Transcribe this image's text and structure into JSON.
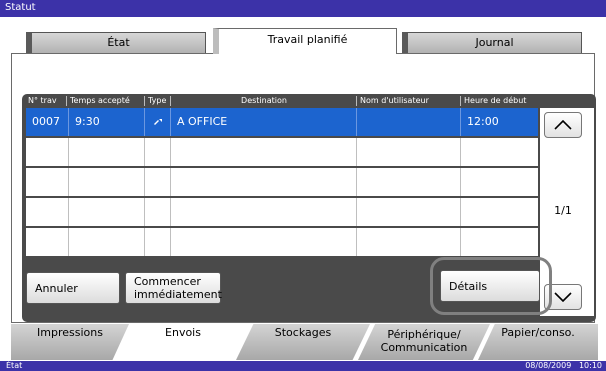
{
  "window": {
    "title": "Statut"
  },
  "top_tabs": [
    {
      "label": "État",
      "active": false
    },
    {
      "label": "Travail planifié",
      "active": true
    },
    {
      "label": "Journal",
      "active": false
    }
  ],
  "table": {
    "headers": [
      "N° trav",
      "Temps accepté",
      "Type",
      "Destination",
      "Nom d'utilisateur",
      "Heure de début"
    ],
    "rows": [
      {
        "job_no": "0007",
        "accepted": "9:30",
        "type_icon": "send-job-icon",
        "destination": "A OFFICE",
        "user": "",
        "start": "12:00",
        "selected": true
      },
      {
        "job_no": "",
        "accepted": "",
        "type_icon": "",
        "destination": "",
        "user": "",
        "start": "",
        "selected": false
      },
      {
        "job_no": "",
        "accepted": "",
        "type_icon": "",
        "destination": "",
        "user": "",
        "start": "",
        "selected": false
      },
      {
        "job_no": "",
        "accepted": "",
        "type_icon": "",
        "destination": "",
        "user": "",
        "start": "",
        "selected": false
      },
      {
        "job_no": "",
        "accepted": "",
        "type_icon": "",
        "destination": "",
        "user": "",
        "start": "",
        "selected": false
      }
    ],
    "page_indicator": "1/1"
  },
  "buttons": {
    "cancel": "Annuler",
    "start_now_line1": "Commencer",
    "start_now_line2": "immédiatement",
    "details": "Détails"
  },
  "bottom_tabs": [
    {
      "line1": "Impressions",
      "line2": "",
      "active": false
    },
    {
      "line1": "Envois",
      "line2": "",
      "active": true
    },
    {
      "line1": "Stockages",
      "line2": "",
      "active": false
    },
    {
      "line1": "Périphérique/",
      "line2": "Communication",
      "active": false
    },
    {
      "line1": "Papier/conso.",
      "line2": "",
      "active": false
    }
  ],
  "status_bar": {
    "status": "État",
    "datetime": "08/08/2009   10:10"
  },
  "colors": {
    "title_bar": "#3c32a8",
    "selected_row": "#1c64cf",
    "table_frame": "#4a4a4a"
  }
}
